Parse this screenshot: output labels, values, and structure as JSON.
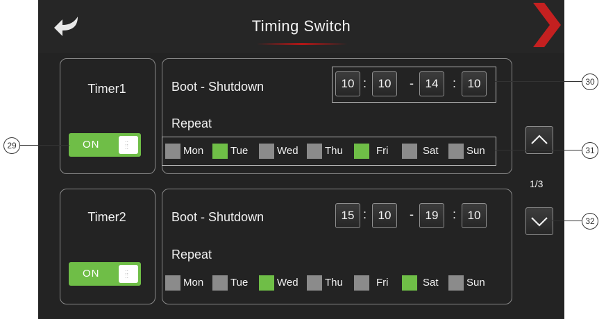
{
  "header": {
    "title": "Timing Switch"
  },
  "timers": [
    {
      "label": "Timer1",
      "boot_label": "Boot - Shutdown",
      "times": [
        "10",
        "10",
        "14",
        "10"
      ],
      "repeat_label": "Repeat",
      "toggle": "ON",
      "days": [
        {
          "name": "Mon",
          "active": false
        },
        {
          "name": "Tue",
          "active": true
        },
        {
          "name": "Wed",
          "active": false
        },
        {
          "name": "Thu",
          "active": false
        },
        {
          "name": "Fri",
          "active": true
        },
        {
          "name": "Sat",
          "active": false
        },
        {
          "name": "Sun",
          "active": false
        }
      ]
    },
    {
      "label": "Timer2",
      "boot_label": "Boot - Shutdown",
      "times": [
        "15",
        "10",
        "19",
        "10"
      ],
      "repeat_label": "Repeat",
      "toggle": "ON",
      "days": [
        {
          "name": "Mon",
          "active": false
        },
        {
          "name": "Tue",
          "active": false
        },
        {
          "name": "Wed",
          "active": true
        },
        {
          "name": "Thu",
          "active": false
        },
        {
          "name": "Fri",
          "active": false
        },
        {
          "name": "Sat",
          "active": true
        },
        {
          "name": "Sun",
          "active": false
        }
      ]
    }
  ],
  "separators": {
    "colon": ":",
    "dash": "-"
  },
  "pagination": {
    "indicator": "1/3"
  },
  "callouts": {
    "c29": "29",
    "c30": "30",
    "c31": "31",
    "c32": "32"
  },
  "colors": {
    "accent_green": "#6fbe47",
    "inactive_day": "#8b8b8b",
    "background": "#232323",
    "brand_red": "#c42020"
  },
  "icons": {
    "back": "back-arrow-icon",
    "next": "next-chevron-icon",
    "up": "chevron-up-icon",
    "down": "chevron-down-icon"
  }
}
